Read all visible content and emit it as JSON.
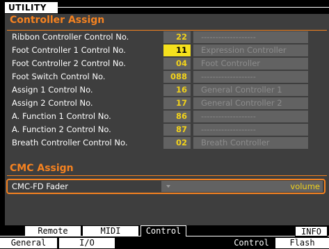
{
  "title": "UTILITY",
  "controller_assign": {
    "heading": "Controller Assign",
    "rows": [
      {
        "name": "Ribbon Controller Control No.",
        "number": "22",
        "description": "-------------------",
        "selected": false
      },
      {
        "name": "Foot Controller 1 Control No.",
        "number": "11",
        "description": "Expression Controller",
        "selected": true
      },
      {
        "name": "Foot Controller 2 Control No.",
        "number": "04",
        "description": "Foot Controller",
        "selected": false
      },
      {
        "name": "Foot Switch Control No.",
        "number": "088",
        "description": "-------------------",
        "selected": false
      },
      {
        "name": "Assign 1 Control No.",
        "number": "16",
        "description": "General Controller 1",
        "selected": false
      },
      {
        "name": "Assign 2 Control No.",
        "number": "17",
        "description": "General Controller 2",
        "selected": false
      },
      {
        "name": "A. Function 1 Control No.",
        "number": "86",
        "description": "-------------------",
        "selected": false
      },
      {
        "name": "A. Function 2 Control No.",
        "number": "87",
        "description": "-------------------",
        "selected": false
      },
      {
        "name": "Breath Controller Control No.",
        "number": "02",
        "description": "Breath Controller",
        "selected": false
      }
    ]
  },
  "cmc_assign": {
    "heading": "CMC Assign",
    "name": "CMC-FD Fader",
    "value": "volume"
  },
  "upper_tabs": {
    "remote": "Remote",
    "midi": "MIDI",
    "control": "Control",
    "info": "INFO"
  },
  "lower_tabs": {
    "general": "General",
    "io": "I/O",
    "control": "Control",
    "flash": "Flash"
  },
  "colors": {
    "accent": "#f58220",
    "value_yellow": "#f2d21a",
    "panel": "#3e3e3e",
    "field": "#626262"
  }
}
